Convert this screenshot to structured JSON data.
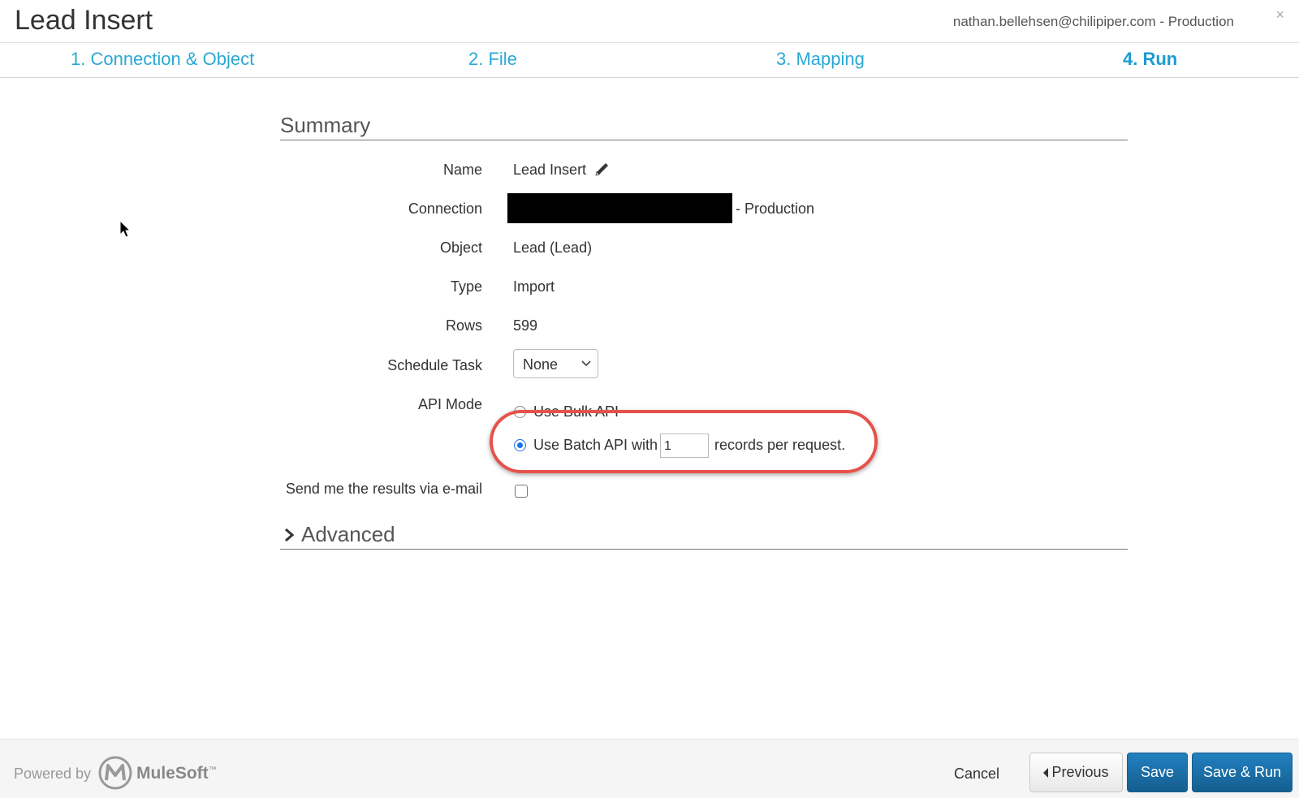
{
  "header": {
    "title": "Lead Insert",
    "account": "nathan.bellehsen@chilipiper.com - Production",
    "close": "×"
  },
  "steps": [
    {
      "label": "1. Connection & Object",
      "active": false
    },
    {
      "label": "2. File",
      "active": false
    },
    {
      "label": "3. Mapping",
      "active": false
    },
    {
      "label": "4. Run",
      "active": true
    }
  ],
  "summary": {
    "heading": "Summary",
    "fields": {
      "name_label": "Name",
      "name_value": "Lead Insert",
      "connection_label": "Connection",
      "connection_suffix": "- Production",
      "object_label": "Object",
      "object_value": "Lead (Lead)",
      "type_label": "Type",
      "type_value": "Import",
      "rows_label": "Rows",
      "rows_value": "599",
      "schedule_label": "Schedule Task",
      "schedule_value": "None",
      "api_mode_label": "API Mode",
      "bulk_option": "Use Bulk API",
      "batch_option_prefix": "Use Batch API with",
      "batch_size": "1",
      "batch_option_suffix": "records per request.",
      "email_label": "Send me the results via e-mail"
    }
  },
  "advanced": {
    "heading": "Advanced"
  },
  "footer": {
    "powered_by": "Powered by",
    "brand": "MuleSoft",
    "tm": "™",
    "cancel": "Cancel",
    "previous": "Previous",
    "save": "Save",
    "save_run": "Save & Run"
  },
  "colors": {
    "accent": "#2aa8d4",
    "primary_button": "#1a6fa8",
    "highlight_ring": "#e5524b",
    "radio_selected": "#1a73e8"
  }
}
